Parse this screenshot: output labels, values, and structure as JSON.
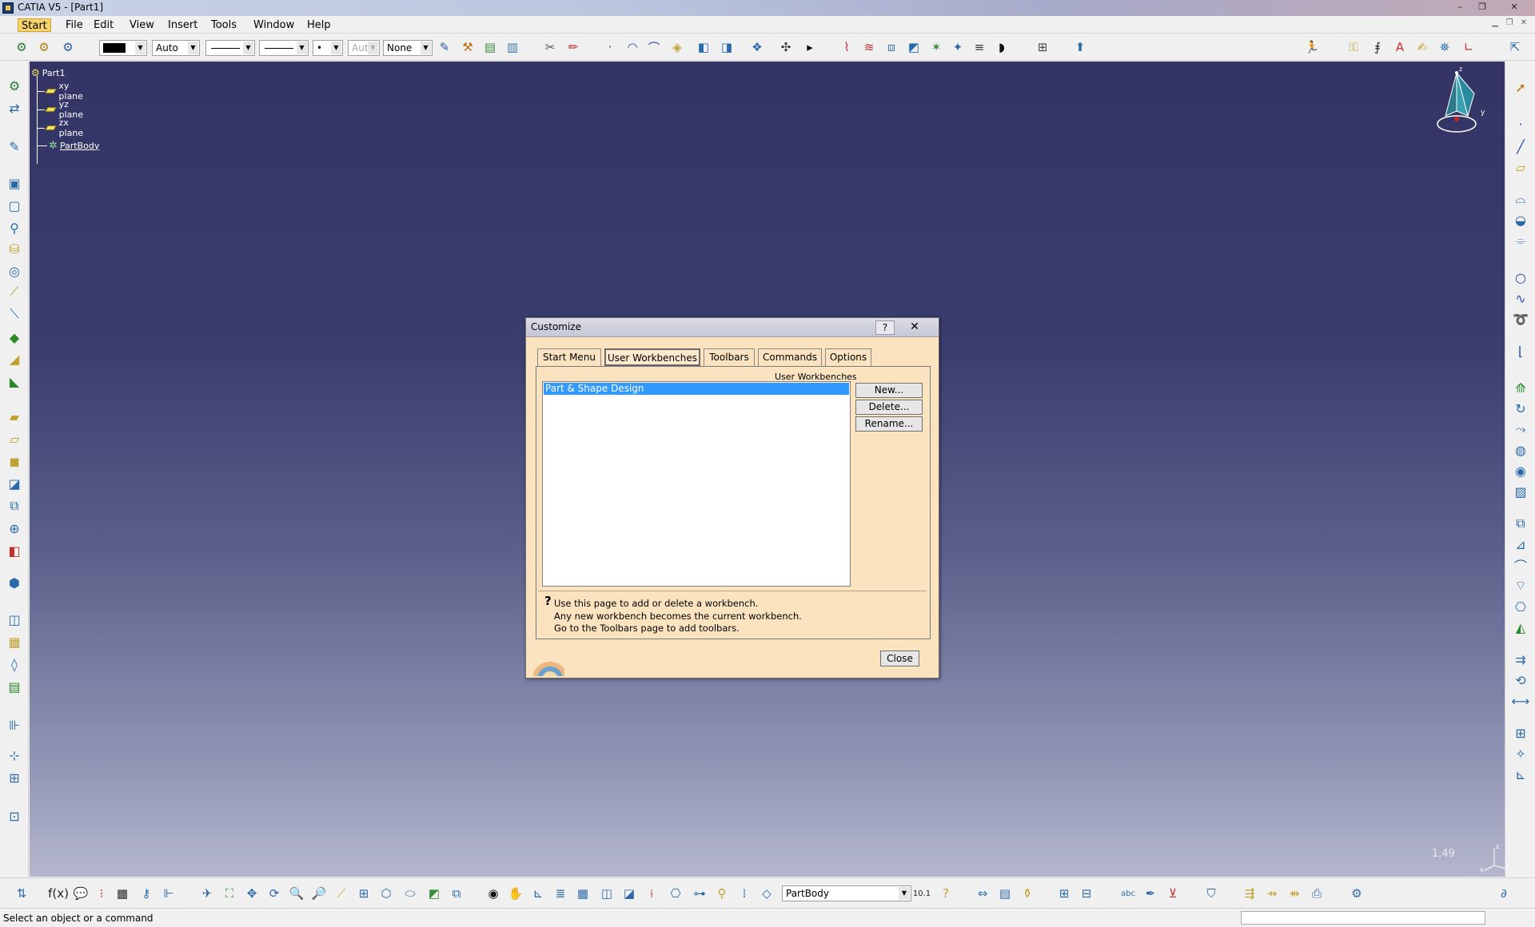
{
  "window": {
    "title": "CATIA V5 - [Part1]",
    "controls": [
      "–",
      "❐",
      "✕"
    ]
  },
  "menu": {
    "items": [
      "Start",
      "File",
      "Edit",
      "View",
      "Insert",
      "Tools",
      "Window",
      "Help"
    ]
  },
  "toolbar_top": {
    "color_combo": "",
    "transparency_combo": "Auto",
    "thickness_combo": "",
    "linetype_combo": "",
    "point_combo": "•",
    "layer_combo_disabled": "Aut",
    "layer_combo": "None"
  },
  "tree": {
    "root": "Part1",
    "nodes": [
      "xy plane",
      "yz plane",
      "zx plane",
      "PartBody"
    ]
  },
  "viewport": {
    "zoom_readout": "1,49"
  },
  "toolbar_bottom": {
    "body_combo": "PartBody"
  },
  "status": {
    "message": "Select an object or a command"
  },
  "dialog": {
    "title": "Customize",
    "help_button": "?",
    "close_icon": "✕",
    "tabs": [
      "Start Menu",
      "User Workbenches",
      "Toolbars",
      "Commands",
      "Options"
    ],
    "selected_tab": "User Workbenches",
    "panel_label": "User Workbenches",
    "workbenches": [
      "Part & Shape Design"
    ],
    "buttons": {
      "new": "New...",
      "delete": "Delete...",
      "rename": "Rename..."
    },
    "help_text": [
      "Use this page to add or delete a workbench.",
      "Any new workbench becomes the current workbench.",
      "Go to the Toolbars page to add toolbars."
    ],
    "close_label": "Close"
  },
  "colors": {
    "dialog_bg": "#fbe3c0",
    "selection": "#3399ff",
    "viewport_top": "#333465",
    "viewport_bottom": "#b4b7cc",
    "menu_active": "#f7d46a"
  }
}
